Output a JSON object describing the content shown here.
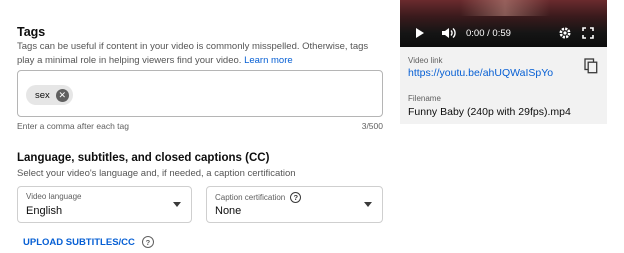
{
  "tags": {
    "title": "Tags",
    "description_line1": "Tags can be useful if content in your video is commonly misspelled. Otherwise, tags play a",
    "description_line2": "minimal role in helping viewers find your video.",
    "learn_more": "Learn more",
    "chips": [
      "sex"
    ],
    "hint": "Enter a comma after each tag",
    "count": "3/500"
  },
  "language": {
    "title": "Language, subtitles, and closed captions (CC)",
    "description": "Select your video's language and, if needed, a caption certification",
    "video_language_label": "Video language",
    "video_language_value": "English",
    "caption_cert_label": "Caption certification",
    "caption_cert_value": "None",
    "upload_label": "UPLOAD SUBTITLES/CC"
  },
  "preview": {
    "time": "0:00 / 0:59",
    "video_link_label": "Video link",
    "video_link": "https://youtu.be/ahUQWaISpYo",
    "filename_label": "Filename",
    "filename": "Funny Baby (240p with 29fps).mp4"
  },
  "icons": {
    "play": "play-icon",
    "volume": "volume-icon",
    "settings": "gear-icon",
    "fullscreen": "fullscreen-icon",
    "copy": "copy-icon",
    "chip_remove": "close-icon",
    "help": "help-icon",
    "dropdown": "chevron-down-icon"
  },
  "colors": {
    "link": "#065fd4",
    "panel_bg": "#f2f2f2"
  }
}
